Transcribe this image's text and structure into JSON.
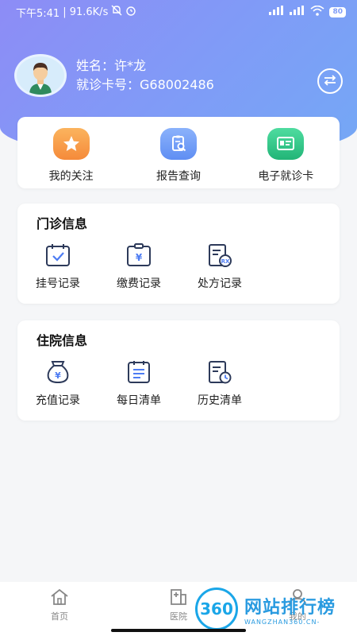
{
  "status_bar": {
    "time": "下午5:41",
    "speed": "| 91.6K/s",
    "battery": "80"
  },
  "profile": {
    "name_label": "姓名：许*龙",
    "card_label": "就诊卡号：G68002486"
  },
  "quick_actions": [
    {
      "label": "我的关注",
      "icon": "star-icon",
      "color": "#f7a04a"
    },
    {
      "label": "报告查询",
      "icon": "report-search-icon",
      "color": "#6f9cf6"
    },
    {
      "label": "电子就诊卡",
      "icon": "card-icon",
      "color": "#38c98c"
    }
  ],
  "outpatient": {
    "title": "门诊信息",
    "items": [
      {
        "label": "挂号记录",
        "icon": "calendar-check-icon"
      },
      {
        "label": "缴费记录",
        "icon": "payment-icon"
      },
      {
        "label": "处方记录",
        "icon": "prescription-icon"
      }
    ]
  },
  "inpatient": {
    "title": "住院信息",
    "items": [
      {
        "label": "充值记录",
        "icon": "money-bag-icon"
      },
      {
        "label": "每日清单",
        "icon": "daily-list-icon"
      },
      {
        "label": "历史清单",
        "icon": "history-list-icon"
      }
    ]
  },
  "tabbar": {
    "tabs": [
      {
        "label": "首页",
        "icon": "home-icon"
      },
      {
        "label": "医院",
        "icon": "hospital-icon"
      },
      {
        "label": "我的",
        "icon": "user-icon"
      }
    ]
  },
  "watermark": {
    "logo_text": "360",
    "title": "网站排行榜",
    "subtitle": "WANGZHAN360.CN-"
  },
  "colors": {
    "hero_start": "#8d8cf6",
    "hero_end": "#74a8f5",
    "icon_stroke": "#2d3a5a"
  }
}
